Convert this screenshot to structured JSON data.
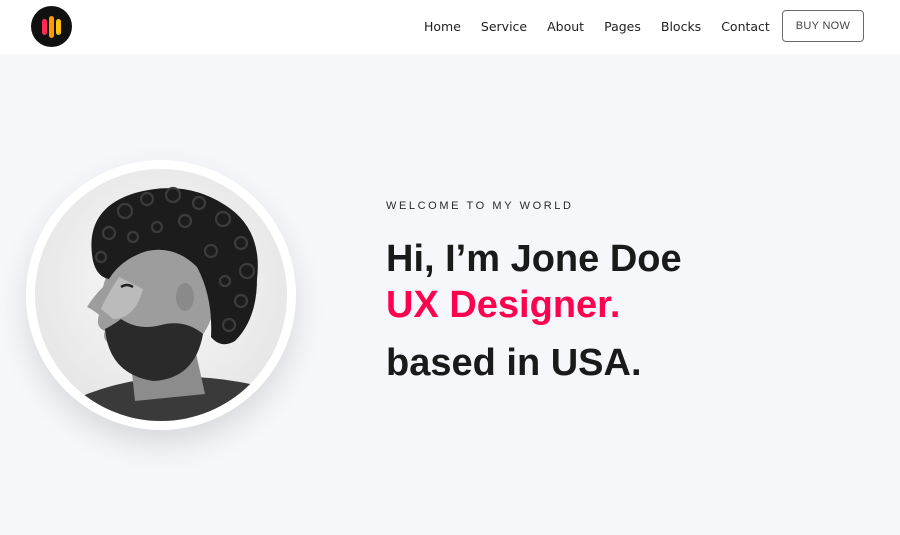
{
  "brand": {
    "logo_name": "logo-icon"
  },
  "nav": {
    "items": [
      {
        "label": "Home"
      },
      {
        "label": "Service"
      },
      {
        "label": "About"
      },
      {
        "label": "Pages"
      },
      {
        "label": "Blocks"
      },
      {
        "label": "Contact"
      }
    ],
    "cta_label": "BUY NOW"
  },
  "hero": {
    "kicker": "WELCOME TO MY WORLD",
    "greeting": "Hi, I’m Jone Doe",
    "role": "UX Designer.",
    "location": "based in USA.",
    "portrait_name": "profile-portrait"
  },
  "colors": {
    "accent": "#ff014f",
    "background": "#f6f7fb",
    "text": "#1a1a1a",
    "logo_bars": [
      "#ff2b55",
      "#ff9800",
      "#ffc107"
    ]
  }
}
